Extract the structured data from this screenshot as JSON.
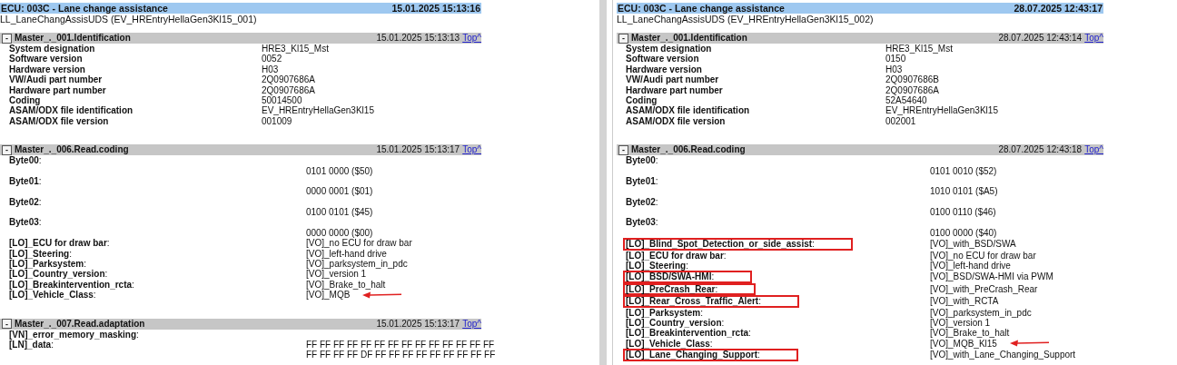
{
  "panes": [
    {
      "header": {
        "title": "ECU: 003C - Lane change assistance",
        "timestamp": "15.01.2025 15:13:16"
      },
      "subtitle": "LL_LaneChangAssisUDS (EV_HREntryHellaGen3Kl15_001)",
      "sections": [
        {
          "toggle": "-",
          "title": "Master_._001.Identification",
          "timestamp": "15.01.2025 15:13:13",
          "top_link": "Top^",
          "kind": "identification",
          "rows": [
            {
              "kind": "pair",
              "label": "System designation",
              "value": "HRE3_Kl15_Mst"
            },
            {
              "kind": "pair",
              "label": "Software version",
              "value": "0052"
            },
            {
              "kind": "pair",
              "label": "Hardware version",
              "value": "H03"
            },
            {
              "kind": "pair",
              "label": "VW/Audi part number",
              "value": "2Q0907686A"
            },
            {
              "kind": "pair",
              "label": "Hardware part number",
              "value": "2Q0907686A"
            },
            {
              "kind": "pair",
              "label": "Coding",
              "value": "50014500"
            },
            {
              "kind": "pair",
              "label": "ASAM/ODX file identification",
              "value": "EV_HREntryHellaGen3Kl15"
            },
            {
              "kind": "pair",
              "label": "ASAM/ODX file version",
              "value": "001009"
            }
          ]
        },
        {
          "toggle": "-",
          "title": "Master_._006.Read.coding",
          "timestamp": "15.01.2025 15:13:17",
          "top_link": "Top^",
          "kind": "coding",
          "rows": [
            {
              "kind": "byte",
              "label": "**Byte00**:",
              "value": "0101 0000 ($50)"
            },
            {
              "kind": "byte",
              "label": "**Byte01**:",
              "value": "0000 0001 ($01)"
            },
            {
              "kind": "byte",
              "label": "**Byte02**:",
              "value": "0100 0101 ($45)"
            },
            {
              "kind": "byte",
              "label": "**Byte03**:",
              "value": "0000 0000 ($00)"
            },
            {
              "kind": "pair",
              "label": "**[LO]_ECU for draw bar**:",
              "value": "[VO]_no ECU for draw bar",
              "highlighted": false,
              "arrow": false
            },
            {
              "kind": "pair",
              "label": "**[LO]_Steering**:",
              "value": "[VO]_left-hand drive",
              "highlighted": false,
              "arrow": false
            },
            {
              "kind": "pair",
              "label": "**[LO]_Parksystem**:",
              "value": "[VO]_parksystem_in_pdc",
              "highlighted": false,
              "arrow": false
            },
            {
              "kind": "pair",
              "label": "**[LO]_Country_version**:",
              "value": "[VO]_version 1",
              "highlighted": false,
              "arrow": false
            },
            {
              "kind": "pair",
              "label": "**[LO]_Breakintervention_rcta**:",
              "value": "[VO]_Brake_to_halt",
              "highlighted": false,
              "arrow": false
            },
            {
              "kind": "pair",
              "label": "**[LO]_Vehicle_Class**:",
              "value": "[VO]_MQB",
              "highlighted": false,
              "arrow": true
            }
          ]
        },
        {
          "toggle": "-",
          "title": "Master_._007.Read.adaptation",
          "timestamp": "15.01.2025 15:13:17",
          "top_link": "Top^",
          "kind": "coding",
          "rows": [
            {
              "kind": "pair",
              "label": "**[VN]_error_memory_masking**:",
              "highlighted": false,
              "arrow": false
            },
            {
              "kind": "multi",
              "label": "**[LN]_data**:",
              "values": [
                "FF FF FF FF FF FF FF FF FF FF FF FF FF FF",
                "FF FF FF FF DF FF FF FF FF FF FF FF FF FF"
              ]
            }
          ]
        }
      ]
    },
    {
      "header": {
        "title": "ECU: 003C - Lane change assistance",
        "timestamp": "28.07.2025 12:43:17"
      },
      "subtitle": "LL_LaneChangAssisUDS (EV_HREntryHellaGen3Kl15_002)",
      "sections": [
        {
          "toggle": "-",
          "title": "Master_._001.Identification",
          "timestamp": "28.07.2025 12:43:14",
          "top_link": "Top^",
          "kind": "identification",
          "rows": [
            {
              "kind": "pair",
              "label": "System designation",
              "value": "HRE3_Kl15_Mst"
            },
            {
              "kind": "pair",
              "label": "Software version",
              "value": "0150"
            },
            {
              "kind": "pair",
              "label": "Hardware version",
              "value": "H03"
            },
            {
              "kind": "pair",
              "label": "VW/Audi part number",
              "value": "2Q0907686B"
            },
            {
              "kind": "pair",
              "label": "Hardware part number",
              "value": "2Q0907686A"
            },
            {
              "kind": "pair",
              "label": "Coding",
              "value": "52A54640"
            },
            {
              "kind": "pair",
              "label": "ASAM/ODX file identification",
              "value": "EV_HREntryHellaGen3Kl15"
            },
            {
              "kind": "pair",
              "label": "ASAM/ODX file version",
              "value": "002001"
            }
          ]
        },
        {
          "toggle": "-",
          "title": "Master_._006.Read.coding",
          "timestamp": "28.07.2025 12:43:18",
          "top_link": "Top^",
          "kind": "coding",
          "rows": [
            {
              "kind": "byte",
              "label": "**Byte00**:",
              "value": "0101 0010 ($52)"
            },
            {
              "kind": "byte",
              "label": "**Byte01**:",
              "value": "1010 0101 ($A5)"
            },
            {
              "kind": "byte",
              "label": "**Byte02**:",
              "value": "0100 0110 ($46)"
            },
            {
              "kind": "byte",
              "label": "**Byte03**:",
              "value": "0100 0000 ($40)"
            },
            {
              "kind": "pair",
              "label": "**[LO]_Blind_Spot_Detection_or_side_assist**:",
              "value": "[VO]_with_BSD/SWA",
              "highlighted": true,
              "arrow": false
            },
            {
              "kind": "pair",
              "label": "**[LO]_ECU for draw bar**:",
              "value": "[VO]_no ECU for draw bar",
              "highlighted": false,
              "arrow": false
            },
            {
              "kind": "pair",
              "label": "**[LO]_Steering**:",
              "value": "[VO]_left-hand drive",
              "highlighted": false,
              "arrow": false
            },
            {
              "kind": "pair",
              "label": "**[LO]_BSD/SWA-HMI**:",
              "value": "[VO]_BSD/SWA-HMI via PWM",
              "highlighted": true,
              "arrow": false
            },
            {
              "kind": "pair",
              "label": "**[LO]_PreCrash_Rear**:",
              "value": "[VO]_with_PreCrash_Rear",
              "highlighted": true,
              "arrow": false
            },
            {
              "kind": "pair",
              "label": "**[LO]_Rear_Cross_Traffic_Alert**:",
              "value": "[VO]_with_RCTA",
              "highlighted": true,
              "arrow": false
            },
            {
              "kind": "pair",
              "label": "**[LO]_Parksystem**:",
              "value": "[VO]_parksystem_in_pdc",
              "highlighted": false,
              "arrow": false
            },
            {
              "kind": "pair",
              "label": "**[LO]_Country_version**:",
              "value": "[VO]_version 1",
              "highlighted": false,
              "arrow": false
            },
            {
              "kind": "pair",
              "label": "**[LO]_Breakintervention_rcta**:",
              "value": "[VO]_Brake_to_halt",
              "highlighted": false,
              "arrow": false
            },
            {
              "kind": "pair",
              "label": "**[LO]_Vehicle_Class**:",
              "value": "[VO]_MQB_Kl15",
              "highlighted": false,
              "arrow": true
            },
            {
              "kind": "pair",
              "label": "**[LO]_Lane_Changing_Support**:",
              "value": "[VO]_with_Lane_Changing_Support",
              "highlighted": true,
              "arrow": false
            }
          ]
        }
      ]
    }
  ]
}
